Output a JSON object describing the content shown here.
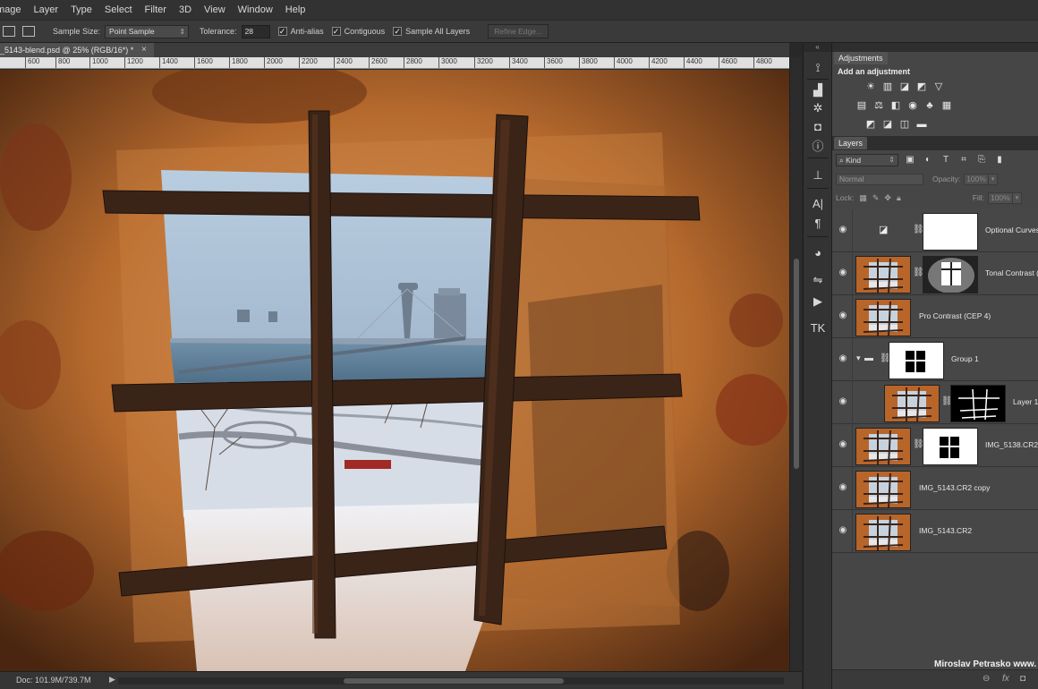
{
  "menu": [
    "mage",
    "Layer",
    "Type",
    "Select",
    "Filter",
    "3D",
    "View",
    "Window",
    "Help"
  ],
  "options": {
    "sample_size_label": "Sample Size:",
    "sample_size_value": "Point Sample",
    "tolerance_label": "Tolerance:",
    "tolerance_value": "28",
    "anti_alias": "Anti-alias",
    "contiguous": "Contiguous",
    "sample_all_layers": "Sample All Layers",
    "refine_edge": "Refine Edge..."
  },
  "document": {
    "tab_title": "_5143-blend.psd @ 25% (RGB/16*) *",
    "close": "×",
    "doc_size": "Doc: 101.9M/739.7M"
  },
  "ruler_ticks": [
    "600",
    "800",
    "1000",
    "1200",
    "1400",
    "1600",
    "1800",
    "2000",
    "2200",
    "2400",
    "2600",
    "2800",
    "3000",
    "3200",
    "3400",
    "3600",
    "3800",
    "4000",
    "4200",
    "4400",
    "4600",
    "4800"
  ],
  "adjustments": {
    "tab": "Adjustments",
    "heading": "Add an adjustment",
    "row1": [
      "☀",
      "▥",
      "◪",
      "◩",
      "▽"
    ],
    "row2": [
      "▤",
      "⚖",
      "◧",
      "◉",
      "♣",
      "▦"
    ],
    "row3": [
      "◩",
      "◪",
      "◫",
      "▬"
    ]
  },
  "layers_panel": {
    "tab": "Layers",
    "kind": "Kind",
    "blend_mode": "Normal",
    "opacity_label": "Opacity:",
    "opacity_value": "100%",
    "lock_label": "Lock:",
    "fill_label": "Fill:",
    "fill_value": "100%",
    "layers": [
      {
        "name": "Optional Curves A"
      },
      {
        "name": "Tonal Contrast (C"
      },
      {
        "name": "Pro Contrast (CEP 4)"
      },
      {
        "name": "Group 1"
      },
      {
        "name": "Layer 1"
      },
      {
        "name": "IMG_5138.CR2"
      },
      {
        "name": "IMG_5143.CR2 copy"
      },
      {
        "name": "IMG_5143.CR2"
      }
    ]
  },
  "watermark": "Miroslav  Petrasko  www.",
  "bottom_icons": [
    "⊖",
    "fx",
    "◘"
  ]
}
